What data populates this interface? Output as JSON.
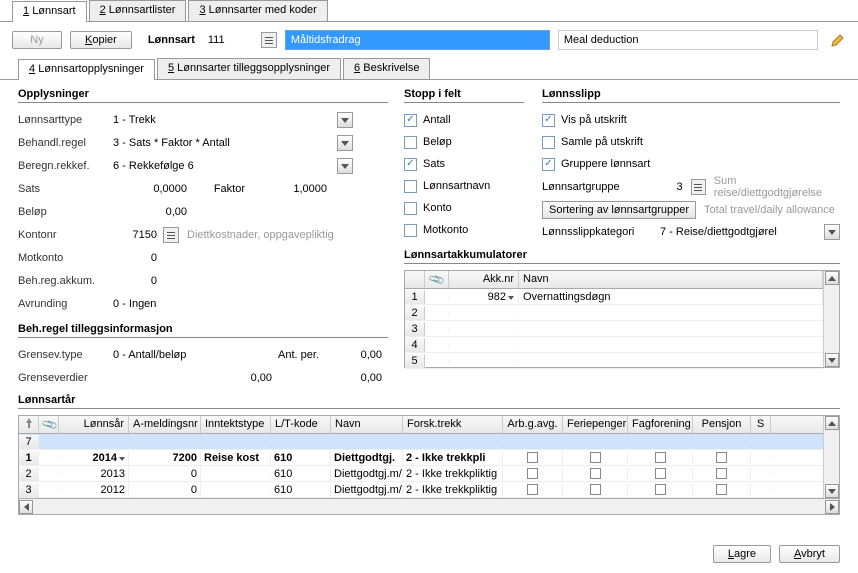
{
  "top_tabs": {
    "t1": {
      "num": "1",
      "label": "Lønnsart"
    },
    "t2": {
      "num": "2",
      "label": "Lønnsartlister"
    },
    "t3": {
      "num": "3",
      "label": "Lønnsarter med koder"
    }
  },
  "toolbar": {
    "ny": "Ny",
    "kopier": "Kopier",
    "lonnsart_label": "Lønnsart",
    "code": "111",
    "name": "Måltidsfradrag",
    "alt_name": "Meal deduction"
  },
  "sub_tabs": {
    "s4": {
      "num": "4",
      "label": "Lønnsartopplysninger"
    },
    "s5": {
      "num": "5",
      "label": "Lønnsarter tilleggsopplysninger"
    },
    "s6": {
      "num": "6",
      "label": "Beskrivelse"
    }
  },
  "opplysninger": {
    "title": "Opplysninger",
    "type_label": "Lønnsarttype",
    "type_val": "1 - Trekk",
    "regel_label": "Behandl.regel",
    "regel_val": "3 - Sats * Faktor * Antall",
    "rekk_label": "Beregn.rekkef.",
    "rekk_val": "6 - Rekkefølge 6",
    "sats_label": "Sats",
    "sats_val": "0,0000",
    "faktor_label": "Faktor",
    "faktor_val": "1,0000",
    "belop_label": "Beløp",
    "belop_val": "0,00",
    "konto_label": "Kontonr",
    "konto_val": "7150",
    "konto_hint": "Diettkostnader, oppgavepliktig",
    "motkonto_label": "Motkonto",
    "motkonto_val": "0",
    "behakk_label": "Beh.reg.akkum.",
    "behakk_val": "0",
    "avr_label": "Avrunding",
    "avr_val": "0 - Ingen"
  },
  "tillegg": {
    "title": "Beh.regel tilleggsinformasjon",
    "gtype_label": "Grensev.type",
    "gtype_val": "0 - Antall/beløp",
    "antper_label": "Ant. per.",
    "antper_val": "0,00",
    "gverd_label": "Grenseverdier",
    "gverd_v1": "0,00",
    "gverd_v2": "0,00"
  },
  "stopp": {
    "title": "Stopp i felt",
    "antall": "Antall",
    "belop": "Beløp",
    "sats": "Sats",
    "navn": "Lønnsartnavn",
    "konto": "Konto",
    "motkonto": "Motkonto"
  },
  "slip": {
    "title": "Lønnsslipp",
    "vis": "Vis på utskrift",
    "samle": "Samle på utskrift",
    "gruppere": "Gruppere lønnsart",
    "grp_label": "Lønnsartgruppe",
    "grp_val": "3",
    "grp_hint1": "Sum reise/diettgodtgjørelse",
    "sort_btn": "Sortering av lønnsartgrupper",
    "grp_hint2": "Total travel/daily allowance",
    "kat_label": "Lønnsslippkategori",
    "kat_val": "7 - Reise/diettgodtgjørel"
  },
  "akk": {
    "title": "Lønnsartakkumulatorer",
    "h_clip": "📎",
    "h_nr": "Akk.nr",
    "h_navn": "Navn",
    "rows": [
      {
        "n": "1",
        "nr": "982",
        "navn": "Overnattingsdøgn"
      },
      {
        "n": "2",
        "nr": "",
        "navn": ""
      },
      {
        "n": "3",
        "nr": "",
        "navn": ""
      },
      {
        "n": "4",
        "nr": "",
        "navn": ""
      },
      {
        "n": "5",
        "nr": "",
        "navn": ""
      }
    ]
  },
  "years": {
    "title": "Lønnsartår",
    "headers": {
      "ar": "Lønnsår",
      "ameld": "A-meldingsnr",
      "innt": "Inntektstype",
      "lt": "L/T-kode",
      "navn": "Navn",
      "forsk": "Forsk.trekk",
      "arbg": "Arb.g.avg.",
      "ferie": "Feriepenger",
      "fag": "Fagforening",
      "pensjon": "Pensjon",
      "s": "S"
    },
    "rows": [
      {
        "n": "7",
        "ar": "",
        "ameld": "",
        "innt": "",
        "lt": "",
        "navn": "",
        "forsk": "",
        "selected": true
      },
      {
        "n": "1",
        "ar": "2014",
        "ameld": "7200",
        "innt": "Reise kost",
        "lt": "610",
        "navn": "Diettgodtgj.",
        "forsk": "2 - Ikke trekkpli",
        "bold": true
      },
      {
        "n": "2",
        "ar": "2013",
        "ameld": "0",
        "innt": "",
        "lt": "610",
        "navn": "Diettgodtgj.m/",
        "forsk": "2 - Ikke trekkpliktig"
      },
      {
        "n": "3",
        "ar": "2012",
        "ameld": "0",
        "innt": "",
        "lt": "610",
        "navn": "Diettgodtgj.m/",
        "forsk": "2 - Ikke trekkpliktig"
      }
    ]
  },
  "footer": {
    "lagre": "Lagre",
    "avbryt": "Avbryt"
  }
}
